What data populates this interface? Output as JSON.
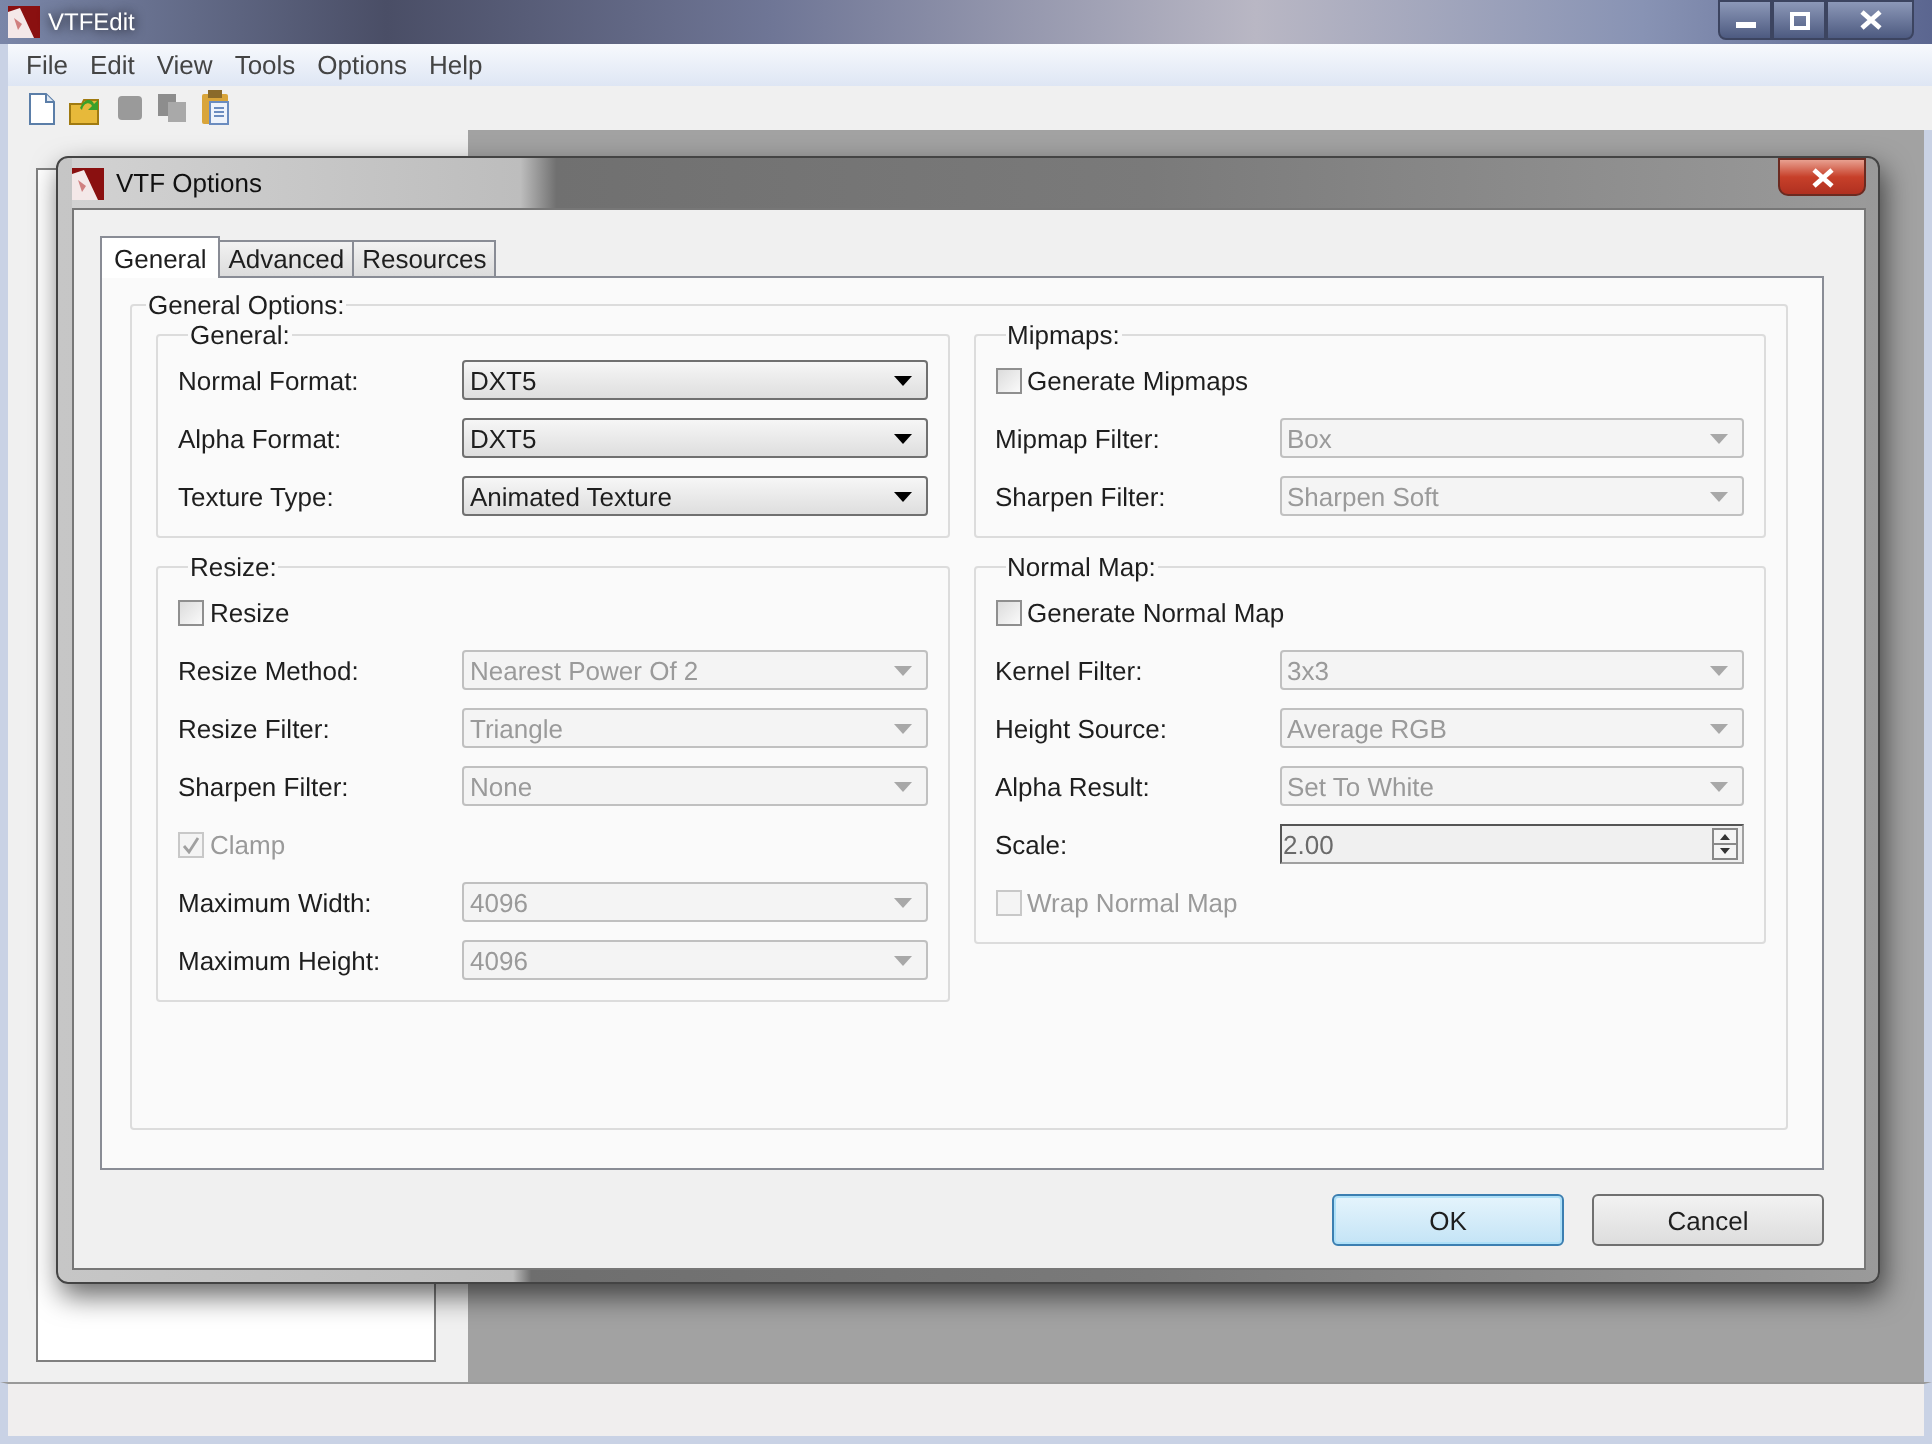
{
  "window": {
    "title": "VTFEdit"
  },
  "menu": [
    "File",
    "Edit",
    "View",
    "Tools",
    "Options",
    "Help"
  ],
  "dialog": {
    "title": "VTF Options",
    "tabs": [
      {
        "label": "General",
        "selected": true
      },
      {
        "label": "Advanced",
        "selected": false
      },
      {
        "label": "Resources",
        "selected": false
      }
    ],
    "group_title": "General Options:",
    "columns": [
      [
        {
          "title": "General:",
          "rows": [
            {
              "kind": "dropdown",
              "label": "Normal Format:",
              "value": "DXT5",
              "disabled": false
            },
            {
              "kind": "dropdown",
              "label": "Alpha Format:",
              "value": "DXT5",
              "disabled": false
            },
            {
              "kind": "dropdown",
              "label": "Texture Type:",
              "value": "Animated Texture",
              "disabled": false
            }
          ]
        },
        {
          "title": "Resize:",
          "rows": [
            {
              "kind": "checkbox",
              "label": "Resize",
              "checked": false,
              "disabled": false
            },
            {
              "kind": "dropdown",
              "label": "Resize Method:",
              "value": "Nearest Power Of 2",
              "disabled": true
            },
            {
              "kind": "dropdown",
              "label": "Resize Filter:",
              "value": "Triangle",
              "disabled": true
            },
            {
              "kind": "dropdown",
              "label": "Sharpen Filter:",
              "value": "None",
              "disabled": true
            },
            {
              "kind": "checkbox",
              "label": "Clamp",
              "checked": true,
              "disabled": true
            },
            {
              "kind": "dropdown",
              "label": "Maximum Width:",
              "value": "4096",
              "disabled": true
            },
            {
              "kind": "dropdown",
              "label": "Maximum Height:",
              "value": "4096",
              "disabled": true
            }
          ]
        }
      ],
      [
        {
          "title": "Mipmaps:",
          "rows": [
            {
              "kind": "checkbox",
              "label": "Generate Mipmaps",
              "checked": false,
              "disabled": false
            },
            {
              "kind": "dropdown",
              "label": "Mipmap Filter:",
              "value": "Box",
              "disabled": true
            },
            {
              "kind": "dropdown",
              "label": "Sharpen Filter:",
              "value": "Sharpen Soft",
              "disabled": true
            }
          ]
        },
        {
          "title": "Normal Map:",
          "rows": [
            {
              "kind": "checkbox",
              "label": "Generate Normal Map",
              "checked": false,
              "disabled": false
            },
            {
              "kind": "dropdown",
              "label": "Kernel Filter:",
              "value": "3x3",
              "disabled": true
            },
            {
              "kind": "dropdown",
              "label": "Height Source:",
              "value": "Average RGB",
              "disabled": true
            },
            {
              "kind": "dropdown",
              "label": "Alpha Result:",
              "value": "Set To White",
              "disabled": true
            },
            {
              "kind": "spinner",
              "label": "Scale:",
              "value": "2.00",
              "disabled": true
            },
            {
              "kind": "checkbox",
              "label": "Wrap Normal Map",
              "checked": false,
              "disabled": true
            }
          ]
        }
      ]
    ],
    "buttons": [
      {
        "label": "OK",
        "default": true
      },
      {
        "label": "Cancel",
        "default": false
      }
    ]
  }
}
